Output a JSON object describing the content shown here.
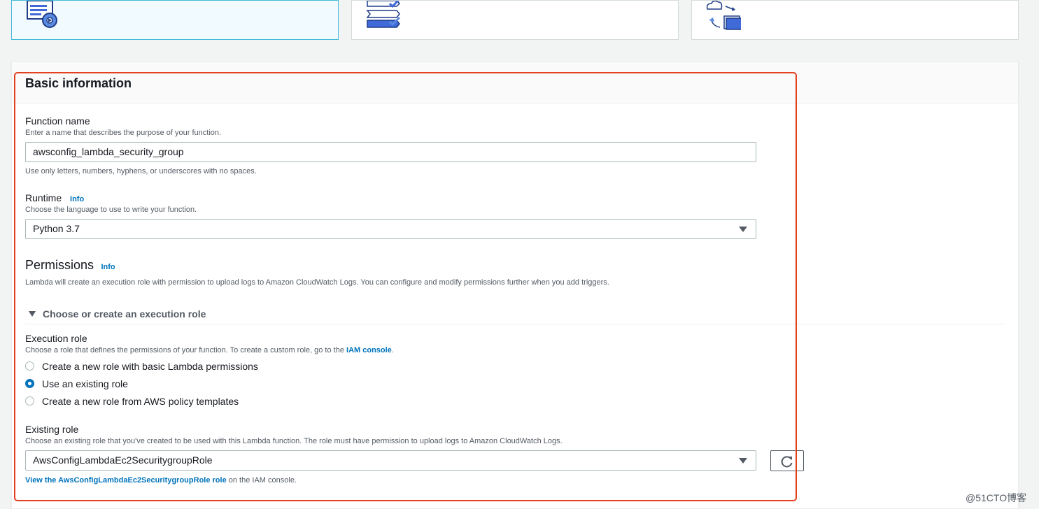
{
  "basic_info": {
    "title": "Basic information",
    "function_name": {
      "label": "Function name",
      "description": "Enter a name that describes the purpose of your function.",
      "value": "awsconfig_lambda_security_group",
      "hint": "Use only letters, numbers, hyphens, or underscores with no spaces."
    },
    "runtime": {
      "label": "Runtime",
      "info": "Info",
      "description": "Choose the language to use to write your function.",
      "selected": "Python 3.7"
    }
  },
  "permissions": {
    "title": "Permissions",
    "info": "Info",
    "description": "Lambda will create an execution role with permission to upload logs to Amazon CloudWatch Logs. You can configure and modify permissions further when you add triggers.",
    "expander_label": "Choose or create an execution role",
    "execution_role": {
      "label": "Execution role",
      "description_prefix": "Choose a role that defines the permissions of your function. To create a custom role, go to the",
      "description_link": "IAM console",
      "description_suffix": ".",
      "options": [
        {
          "label": "Create a new role with basic Lambda permissions",
          "checked": false
        },
        {
          "label": "Use an existing role",
          "checked": true
        },
        {
          "label": "Create a new role from AWS policy templates",
          "checked": false
        }
      ]
    },
    "existing_role": {
      "label": "Existing role",
      "description": "Choose an existing role that you've created to be used with this Lambda function. The role must have permission to upload logs to Amazon CloudWatch Logs.",
      "selected": "AwsConfigLambdaEc2SecuritygroupRole",
      "view_link": "View the AwsConfigLambdaEc2SecuritygroupRole role",
      "view_suffix": "on the IAM console."
    }
  },
  "watermark": "@51CTO博客",
  "colors": {
    "accent": "#0073bb",
    "highlight_border": "#e2401f",
    "selected_card_border": "#44b9d6"
  },
  "icons": {
    "card_1": "author-from-scratch-icon",
    "card_2": "blueprints-icon",
    "card_3": "serverless-app-repository-icon",
    "refresh": "refresh-icon",
    "expander": "caret-down-icon"
  }
}
